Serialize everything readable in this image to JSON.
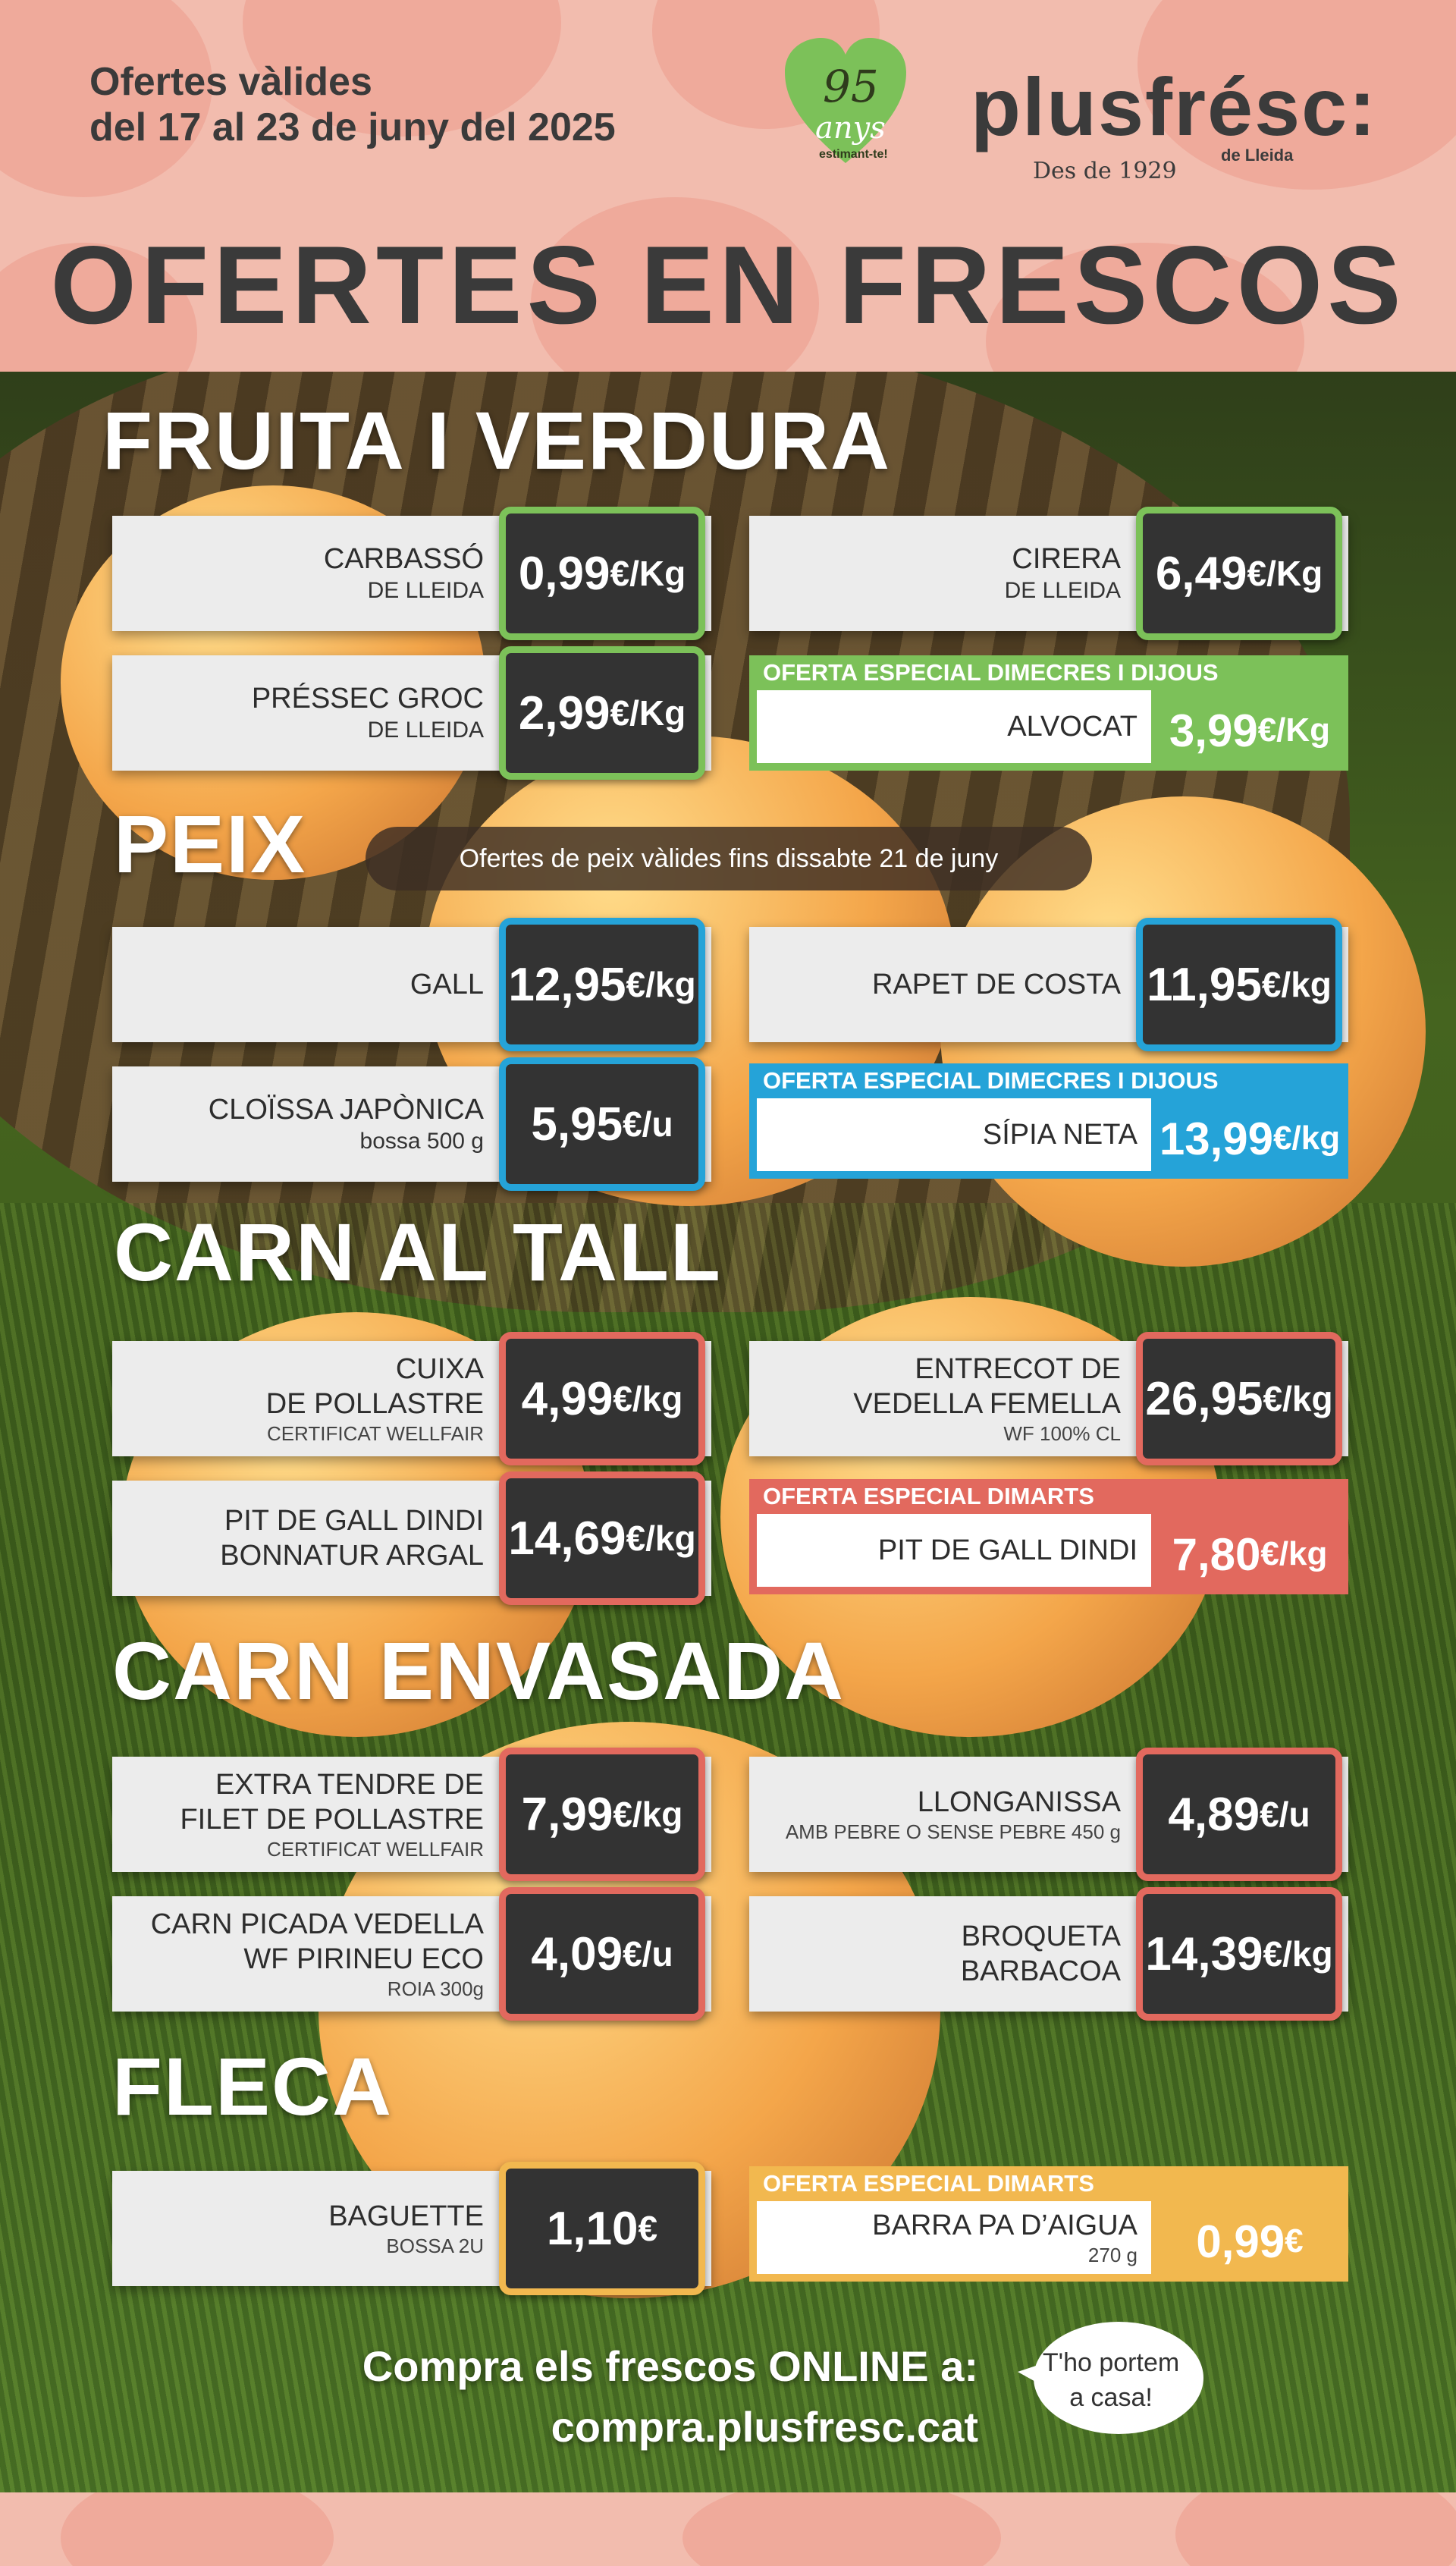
{
  "header": {
    "validity_line1": "Ofertes vàlides",
    "validity_line2": "del 17 al 23 de juny del 2025",
    "badge_number": "95",
    "badge_word": "anys",
    "badge_tag": "estimant-te!",
    "brand_name": "plusfrésc:",
    "brand_since": "Des de 1929",
    "brand_city": "de Lleida",
    "main_title": "OFERTES EN FRESCOS"
  },
  "colors": {
    "header_pink": "#f2bcae",
    "fruit_green": "#7cc159",
    "fish_blue": "#25a3d8",
    "meat_red": "#e2695e",
    "bakery_yellow": "#f2b84f",
    "price_box": "#333333"
  },
  "sections": {
    "fruita": {
      "title": "FRUITA I VERDURA",
      "items": [
        {
          "name1": "CARBASSÓ",
          "name2": "DE LLEIDA",
          "price": "0,99",
          "unit": " €/Kg"
        },
        {
          "name1": "CIRERA",
          "name2": "DE LLEIDA",
          "price": "6,49",
          "unit": " €/Kg"
        },
        {
          "name1": "PRÉSSEC GROC",
          "name2": "DE LLEIDA",
          "price": "2,99",
          "unit": " €/Kg"
        }
      ],
      "special": {
        "band": "OFERTA ESPECIAL DIMECRES I DIJOUS",
        "name": "ALVOCAT",
        "price": "3,99",
        "unit": " €/Kg"
      }
    },
    "peix": {
      "title": "PEIX",
      "note": "Ofertes de peix vàlides fins dissabte 21 de juny",
      "items": [
        {
          "name1": "GALL",
          "price": "12,95",
          "unit": " €/kg"
        },
        {
          "name1": "RAPET DE COSTA",
          "price": "11,95",
          "unit": " €/kg"
        },
        {
          "name1": "CLOÏSSA JAPÒNICA",
          "name2": "bossa 500 g",
          "price": "5,95",
          "unit": " €/u"
        }
      ],
      "special": {
        "band": "OFERTA ESPECIAL DIMECRES I DIJOUS",
        "name": "SÍPIA NETA",
        "price": "13,99",
        "unit": " €/kg"
      }
    },
    "carn_tall": {
      "title": "CARN AL TALL",
      "items": [
        {
          "name1": "CUIXA",
          "name2": "DE POLLASTRE",
          "name3": "CERTIFICAT WELLFAIR",
          "price": "4,99",
          "unit": " €/kg"
        },
        {
          "name1": "ENTRECOT DE",
          "name2": "VEDELLA FEMELLA",
          "name3": "WF 100% CL",
          "price": "26,95",
          "unit": " €/kg"
        },
        {
          "name1": "PIT DE GALL DINDI",
          "name2": "BONNATUR ARGAL",
          "price": "14,69",
          "unit": " €/kg"
        }
      ],
      "special": {
        "band": "OFERTA ESPECIAL DIMARTS",
        "name": "PIT DE GALL DINDI",
        "price": "7,80",
        "unit": " €/kg"
      }
    },
    "carn_envasada": {
      "title": "CARN ENVASADA",
      "items": [
        {
          "name1": "EXTRA TENDRE DE",
          "name2": "FILET DE POLLASTRE",
          "name3": "CERTIFICAT WELLFAIR",
          "price": "7,99",
          "unit": " €/kg"
        },
        {
          "name1": "LLONGANISSA",
          "name3": "AMB PEBRE O SENSE PEBRE 450 g",
          "price": "4,89",
          "unit": " €/u"
        },
        {
          "name1": "CARN PICADA VEDELLA",
          "name2": "WF PIRINEU ECO",
          "name3": "ROIA 300g",
          "price": "4,09",
          "unit": " €/u"
        },
        {
          "name1": "BROQUETA",
          "name2": "BARBACOA",
          "price": "14,39",
          "unit": " €/kg"
        }
      ]
    },
    "fleca": {
      "title": "FLECA",
      "items": [
        {
          "name1": "BAGUETTE",
          "name3": "BOSSA 2U",
          "price": "1,10",
          "unit": " €"
        }
      ],
      "special": {
        "band": "OFERTA ESPECIAL DIMARTS",
        "name": "BARRA PA D’AIGUA",
        "sub": "270 g",
        "price": "0,99",
        "unit": " €"
      }
    }
  },
  "footer": {
    "cta_line1": "Compra els frescos ONLINE a:",
    "cta_line2": "compra.plusfresc.cat",
    "bubble_line1": "T'ho portem",
    "bubble_line2": "a casa!"
  }
}
